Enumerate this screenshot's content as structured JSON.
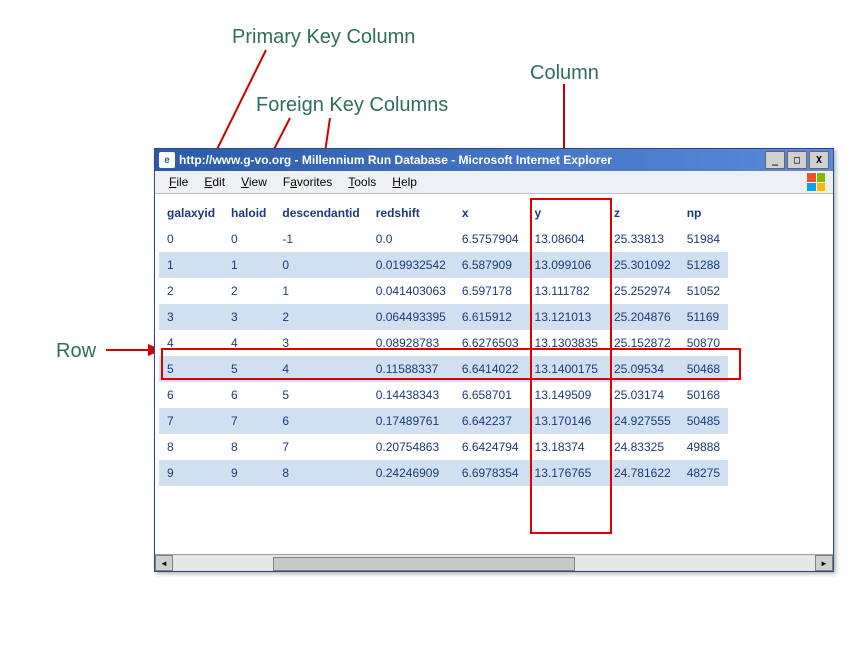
{
  "annotations": {
    "primary_key": "Primary Key Column",
    "foreign_keys": "Foreign Key Columns",
    "column": "Column",
    "row": "Row"
  },
  "window": {
    "title": "http://www.g-vo.org - Millennium Run Database - Microsoft Internet Explorer",
    "controls": {
      "min": "_",
      "max": "□",
      "close": "X"
    }
  },
  "menubar": {
    "items": [
      "File",
      "Edit",
      "View",
      "Favorites",
      "Tools",
      "Help"
    ]
  },
  "table": {
    "headers": [
      "galaxyid",
      "haloid",
      "descendantid",
      "redshift",
      "x",
      "y",
      "z",
      "np"
    ],
    "rows": [
      [
        "0",
        "0",
        "-1",
        "0.0",
        "6.5757904",
        "13.08604",
        "25.33813",
        "51984"
      ],
      [
        "1",
        "1",
        "0",
        "0.019932542",
        "6.587909",
        "13.099106",
        "25.301092",
        "51288"
      ],
      [
        "2",
        "2",
        "1",
        "0.041403063",
        "6.597178",
        "13.111782",
        "25.252974",
        "51052"
      ],
      [
        "3",
        "3",
        "2",
        "0.064493395",
        "6.615912",
        "13.121013",
        "25.204876",
        "51169"
      ],
      [
        "4",
        "4",
        "3",
        "0.08928783",
        "6.6276503",
        "13.1303835",
        "25.152872",
        "50870"
      ],
      [
        "5",
        "5",
        "4",
        "0.11588337",
        "6.6414022",
        "13.1400175",
        "25.09534",
        "50468"
      ],
      [
        "6",
        "6",
        "5",
        "0.14438343",
        "6.658701",
        "13.149509",
        "25.03174",
        "50168"
      ],
      [
        "7",
        "7",
        "6",
        "0.17489761",
        "6.642237",
        "13.170146",
        "24.927555",
        "50485"
      ],
      [
        "8",
        "8",
        "7",
        "0.20754863",
        "6.6424794",
        "13.18374",
        "24.83325",
        "49888"
      ],
      [
        "9",
        "9",
        "8",
        "0.24246909",
        "6.6978354",
        "13.176765",
        "24.781622",
        "48275"
      ]
    ]
  }
}
